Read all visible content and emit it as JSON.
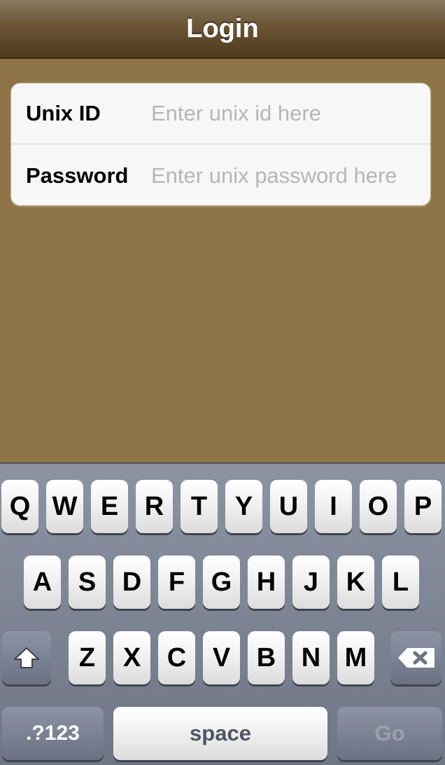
{
  "navbar": {
    "title": "Login"
  },
  "form": {
    "unix_id": {
      "label": "Unix ID",
      "placeholder": "Enter unix id here",
      "value": ""
    },
    "password": {
      "label": "Password",
      "placeholder": "Enter unix password here",
      "value": ""
    }
  },
  "keyboard": {
    "row1": [
      "Q",
      "W",
      "E",
      "R",
      "T",
      "Y",
      "U",
      "I",
      "O",
      "P"
    ],
    "row2": [
      "A",
      "S",
      "D",
      "F",
      "G",
      "H",
      "J",
      "K",
      "L"
    ],
    "row3": [
      "Z",
      "X",
      "C",
      "V",
      "B",
      "N",
      "M"
    ],
    "shift_icon": "shift-icon",
    "delete_icon": "backspace-icon",
    "numbers_label": ".?123",
    "space_label": "space",
    "go_label": "Go"
  },
  "colors": {
    "background": "#8e7346",
    "navbar_dark": "#4f3a1e",
    "keyboard": "#7a8191",
    "placeholder": "#b6b6b6"
  }
}
